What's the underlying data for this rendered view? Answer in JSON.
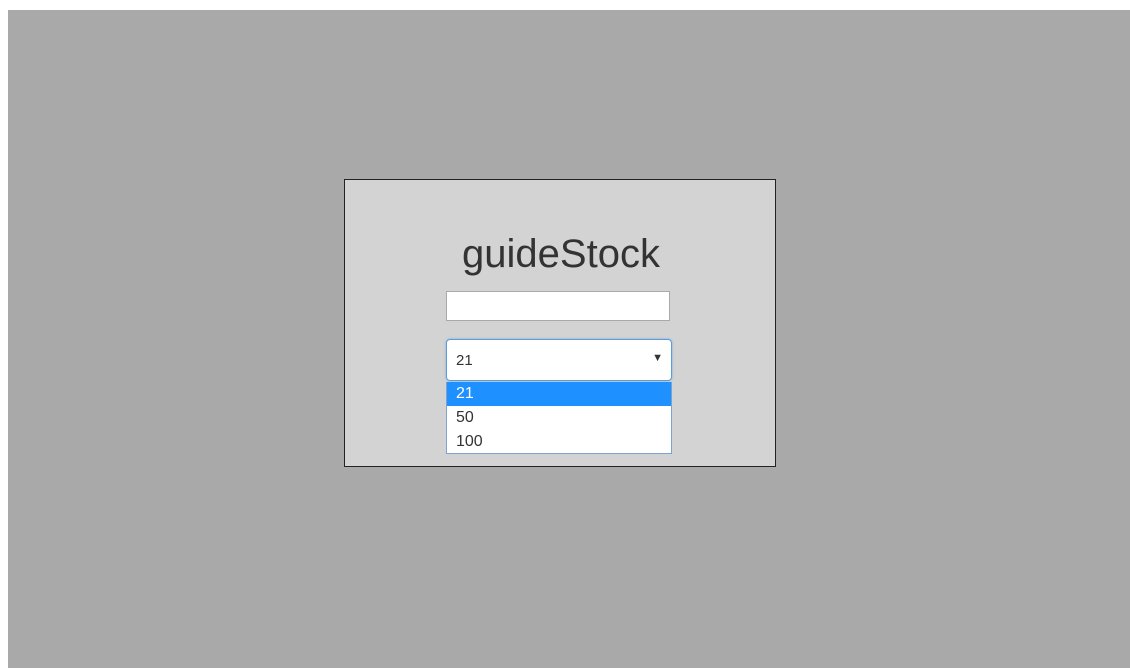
{
  "app": {
    "title": "guideStock"
  },
  "search": {
    "value": "",
    "placeholder": ""
  },
  "page_size_select": {
    "selected": "21",
    "arrow_icon": "caret-down-icon",
    "options": [
      "21",
      "50",
      "100"
    ],
    "highlighted_index": 0
  },
  "colors": {
    "background": "#a9a9a9",
    "dialog": "#d3d3d3",
    "highlight": "#1e90ff",
    "focus_border": "#5b9dd9"
  }
}
